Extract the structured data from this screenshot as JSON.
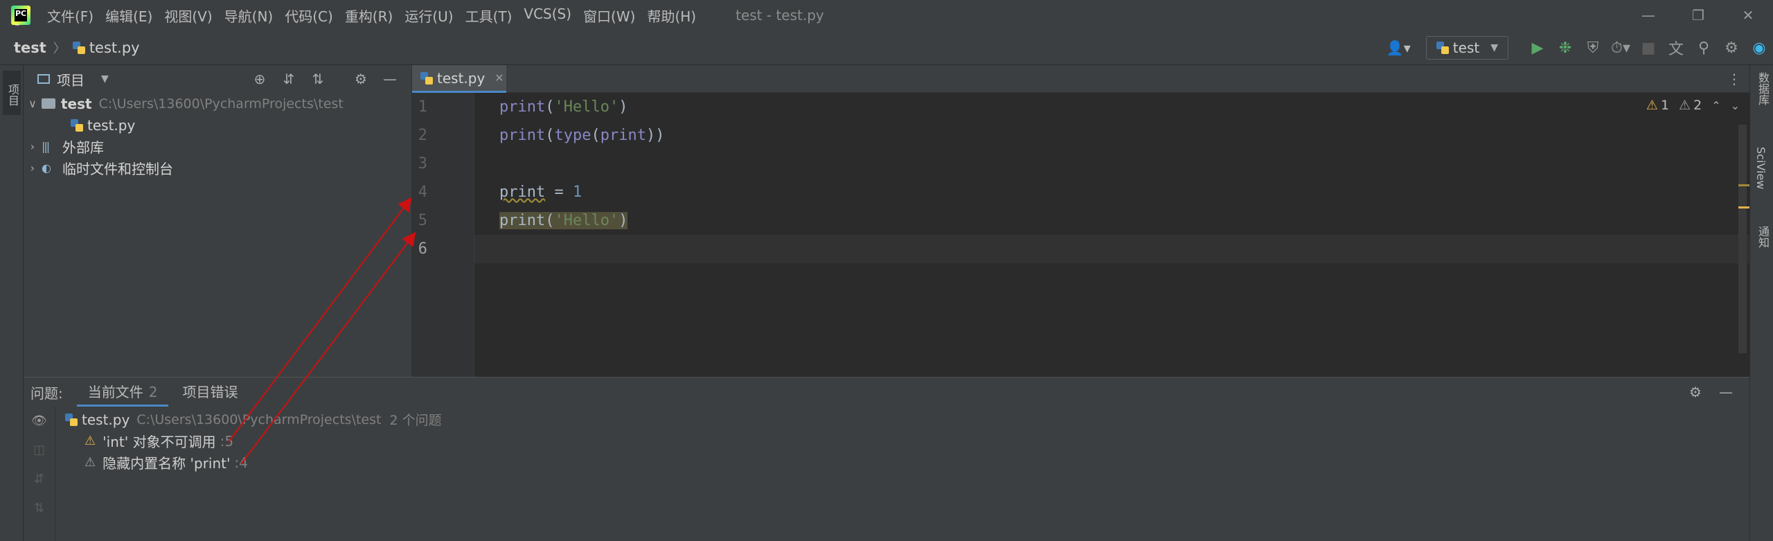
{
  "menu": {
    "items": [
      "文件(F)",
      "编辑(E)",
      "视图(V)",
      "导航(N)",
      "代码(C)",
      "重构(R)",
      "运行(U)",
      "工具(T)",
      "VCS(S)",
      "窗口(W)",
      "帮助(H)"
    ],
    "window_title": "test - test.py"
  },
  "navbar": {
    "project": "test",
    "file": "test.py",
    "run_config": "test"
  },
  "left_strip": {
    "project_tab": "项目"
  },
  "right_strip": {
    "database": "数据库",
    "sciview": "SciView",
    "notifications": "通知"
  },
  "project_panel": {
    "title": "项目",
    "tree": [
      {
        "name": "test",
        "path": "C:\\Users\\13600\\PycharmProjects\\test"
      },
      {
        "name": "test.py"
      },
      {
        "name": "外部库"
      },
      {
        "name": "临时文件和控制台"
      }
    ]
  },
  "editor": {
    "tab_label": "test.py",
    "line_numbers": [
      "1",
      "2",
      "3",
      "4",
      "5",
      "6"
    ],
    "code": {
      "l1_fn": "print",
      "l1_open": "(",
      "l1_str": "'Hello'",
      "l1_close": ")",
      "l2_fn": "print",
      "l2_open": "(",
      "l2_type": "type",
      "l2_open2": "(",
      "l2_inner": "print",
      "l2_close": "))",
      "l4_name": "print",
      "l4_op": " = ",
      "l4_num": "1",
      "l5_fn": "print",
      "l5_open": "(",
      "l5_str": "'Hello'",
      "l5_close": ")"
    },
    "inspections": {
      "warnings": "1",
      "weak_warnings": "2"
    }
  },
  "problems": {
    "label": "问题:",
    "tabs": [
      {
        "label": "当前文件",
        "count": "2"
      },
      {
        "label": "项目错误"
      }
    ],
    "file": {
      "name": "test.py",
      "path": "C:\\Users\\13600\\PycharmProjects\\test",
      "summary": "2 个问题"
    },
    "items": [
      {
        "message": "'int' 对象不可调用",
        "line": ":5"
      },
      {
        "message": "隐藏内置名称 'print'",
        "line": ":4"
      }
    ]
  },
  "colors": {
    "accent": "#4a88c7",
    "warning": "#e2b34b",
    "annotation_arrow": "#cc1111",
    "run_green": "#59a869"
  },
  "icons": [
    "pycharm-logo",
    "user-icon",
    "run-icon",
    "debug-icon",
    "coverage-icon",
    "profile-icon",
    "stop-icon",
    "translate-icon",
    "search-icon",
    "gear-icon",
    "ide-logo",
    "locate-icon",
    "expand-all-icon",
    "collapse-all-icon",
    "minimize-icon",
    "eye-icon",
    "warning-icon",
    "close-icon"
  ]
}
